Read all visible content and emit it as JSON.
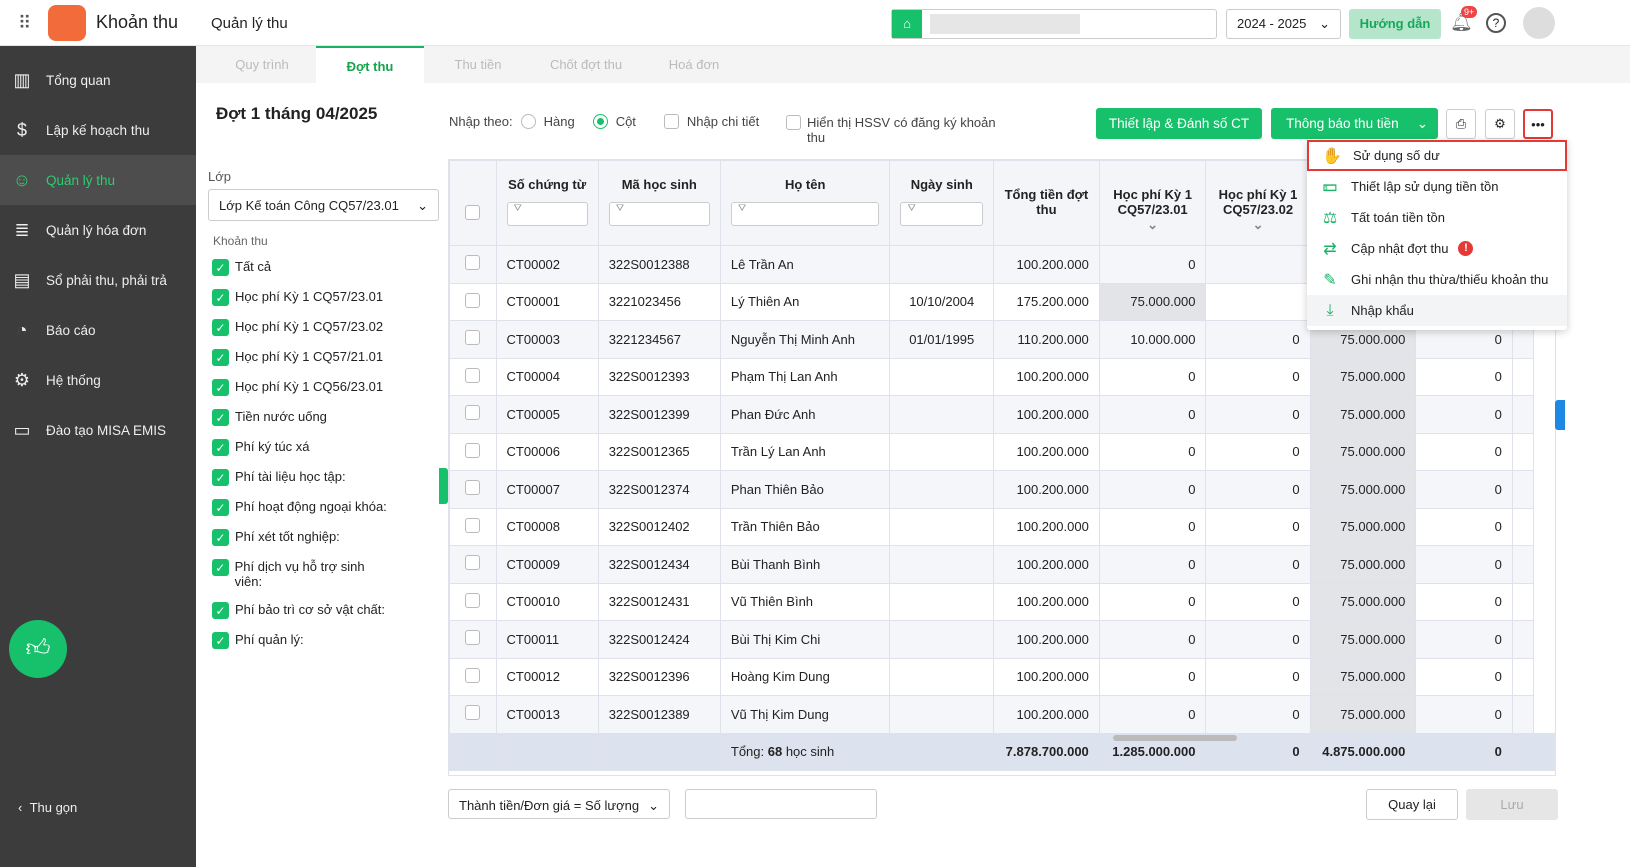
{
  "app": {
    "name": "Khoản thu",
    "module": "Quản lý thu",
    "year": "2024 - 2025",
    "guide": "Hướng dẫn",
    "notif_badge": "9+"
  },
  "sidebar": {
    "items": [
      {
        "label": "Tổng quan"
      },
      {
        "label": "Lập kế hoạch thu"
      },
      {
        "label": "Quản lý thu"
      },
      {
        "label": "Quản lý hóa đơn"
      },
      {
        "label": "Sổ phải thu, phải trả"
      },
      {
        "label": "Báo cáo"
      },
      {
        "label": "Hệ thống"
      },
      {
        "label": "Đào tạo MISA EMIS"
      }
    ],
    "collapse": "Thu gọn"
  },
  "tabs": [
    "Quy trình",
    "Đợt thu",
    "Thu tiền",
    "Chốt đợt thu",
    "Hoá đơn"
  ],
  "page": {
    "title": "Đợt 1 tháng 04/2025",
    "class_label": "Lớp",
    "class_value": "Lớp Kế toán Công CQ57/23.01",
    "fees_label": "Khoản thu",
    "fees": [
      "Tất cả",
      "Học phí Kỳ 1 CQ57/23.01",
      "Học phí Kỳ 1 CQ57/23.02",
      "Học phí Kỳ 1 CQ57/21.01",
      "Học phí Kỳ 1 CQ56/23.01",
      "Tiền nước uống",
      "Phí ký túc xá",
      "Phí tài liệu học tập:",
      "Phí hoạt động ngoại khóa:",
      "Phí xét tốt nghiệp:",
      "Phí dịch vụ hỗ trợ sinh viên:",
      "Phí bảo trì cơ sở vật chất:",
      "Phí quản lý:"
    ]
  },
  "toolbar": {
    "input_by": "Nhập theo:",
    "row": "Hàng",
    "col": "Cột",
    "detail": "Nhập chi tiết",
    "show_hssv": "Hiển thị HSSV có đăng ký khoản thu",
    "setup": "Thiết lập & Đánh số CT",
    "notify": "Thông báo thu tiền"
  },
  "menu": [
    {
      "label": "Sử dụng số dư",
      "icon": "hand-coin-icon"
    },
    {
      "label": "Thiết lập sử dụng tiền tồn",
      "icon": "money-hand-icon"
    },
    {
      "label": "Tất toán tiền tồn",
      "icon": "scale-icon"
    },
    {
      "label": "Cập nhật đợt thu",
      "icon": "swap-icon"
    },
    {
      "label": "Ghi nhận thu thừa/thiếu khoản thu",
      "icon": "pencil-icon"
    },
    {
      "label": "Nhập khẩu",
      "icon": "import-icon"
    }
  ],
  "table": {
    "headers": [
      "Số chứng từ",
      "Mã học sinh",
      "Họ tên",
      "Ngày sinh",
      "Tổng tiền đợt thu",
      "Học phí Kỳ 1 CQ57/23.01",
      "Học phí Kỳ 1 CQ57/23.02",
      "",
      ""
    ],
    "rows": [
      [
        "CT00002",
        "322S0012388",
        "Lê Trần An",
        "",
        "100.200.000",
        "0",
        "",
        "",
        ""
      ],
      [
        "CT00001",
        "3221023456",
        "Lý Thiên An",
        "10/10/2004",
        "175.200.000",
        "75.000.000",
        "",
        "",
        ""
      ],
      [
        "CT00003",
        "3221234567",
        "Nguyễn Thị Minh Anh",
        "01/01/1995",
        "110.200.000",
        "10.000.000",
        "0",
        "75.000.000",
        "0"
      ],
      [
        "CT00004",
        "322S0012393",
        "Phạm Thị Lan Anh",
        "",
        "100.200.000",
        "0",
        "0",
        "75.000.000",
        "0"
      ],
      [
        "CT00005",
        "322S0012399",
        "Phan Đức Anh",
        "",
        "100.200.000",
        "0",
        "0",
        "75.000.000",
        "0"
      ],
      [
        "CT00006",
        "322S0012365",
        "Trần Lý Lan Anh",
        "",
        "100.200.000",
        "0",
        "0",
        "75.000.000",
        "0"
      ],
      [
        "CT00007",
        "322S0012374",
        "Phan Thiên Bảo",
        "",
        "100.200.000",
        "0",
        "0",
        "75.000.000",
        "0"
      ],
      [
        "CT00008",
        "322S0012402",
        "Trần Thiên Bảo",
        "",
        "100.200.000",
        "0",
        "0",
        "75.000.000",
        "0"
      ],
      [
        "CT00009",
        "322S0012434",
        "Bùi Thanh Bình",
        "",
        "100.200.000",
        "0",
        "0",
        "75.000.000",
        "0"
      ],
      [
        "CT00010",
        "322S0012431",
        "Vũ Thiên Bình",
        "",
        "100.200.000",
        "0",
        "0",
        "75.000.000",
        "0"
      ],
      [
        "CT00011",
        "322S0012424",
        "Bùi Thị Kim Chi",
        "",
        "100.200.000",
        "0",
        "0",
        "75.000.000",
        "0"
      ],
      [
        "CT00012",
        "322S0012396",
        "Hoàng Kim Dung",
        "",
        "100.200.000",
        "0",
        "0",
        "75.000.000",
        "0"
      ],
      [
        "CT00013",
        "322S0012389",
        "Vũ Thị Kim Dung",
        "",
        "100.200.000",
        "0",
        "0",
        "75.000.000",
        "0"
      ]
    ],
    "footer": {
      "total_prefix": "Tổng: ",
      "count": "68",
      "total_suffix": " học sinh",
      "values": [
        "7.878.700.000",
        "1.285.000.000",
        "0",
        "4.875.000.000",
        "0"
      ]
    }
  },
  "bottom": {
    "formula": "Thành tiền/Đơn giá = Số lượng",
    "back": "Quay lại",
    "save": "Lưu"
  },
  "colors": {
    "green": "#17c06b",
    "sidebar": "#3c3c3c"
  }
}
